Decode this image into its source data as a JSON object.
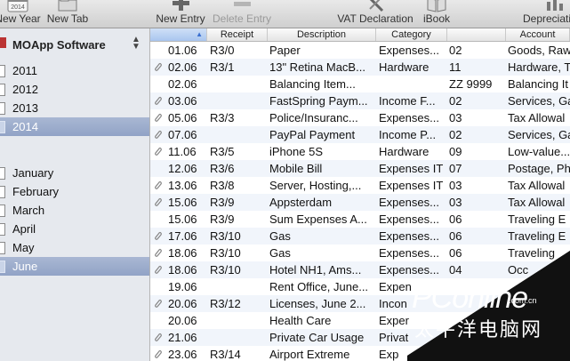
{
  "toolbar": {
    "new_year": "New Year",
    "new_tab": "New Tab",
    "new_entry": "New Entry",
    "delete_entry": "Delete Entry",
    "vat_declaration": "VAT Declaration",
    "ibook": "iBook",
    "depreciations": "Depreciations",
    "calendar_badge": "2014"
  },
  "sidebar": {
    "company": "MOApp Software",
    "years": [
      "2011",
      "2012",
      "2013",
      "2014"
    ],
    "months": [
      "January",
      "February",
      "March",
      "April",
      "May",
      "June"
    ]
  },
  "table": {
    "headers": [
      "Receipt",
      "Description",
      "Category",
      "Account"
    ],
    "rows": [
      {
        "date": "01.06",
        "receipt": "R3/0",
        "desc": "Paper",
        "cat": "Expenses...",
        "acct": "02",
        "acct_name": "Goods, Raw",
        "clip": false
      },
      {
        "date": "02.06",
        "receipt": "R3/1",
        "desc": "13\" Retina MacB...",
        "cat": "Hardware",
        "acct": "11",
        "acct_name": "Hardware, T",
        "clip": true
      },
      {
        "date": "02.06",
        "receipt": "",
        "desc": "Balancing Item...",
        "cat": "",
        "acct": "ZZ 9999",
        "acct_name": "Balancing It",
        "clip": false
      },
      {
        "date": "03.06",
        "receipt": "",
        "desc": "FastSpring Paym...",
        "cat": "Income F...",
        "acct": "02",
        "acct_name": "Services, Ga",
        "clip": true
      },
      {
        "date": "05.06",
        "receipt": "R3/3",
        "desc": "Police/Insuranc...",
        "cat": "Expenses...",
        "acct": "03",
        "acct_name": "Tax Allowal",
        "clip": true
      },
      {
        "date": "07.06",
        "receipt": "",
        "desc": "PayPal Payment",
        "cat": "Income P...",
        "acct": "02",
        "acct_name": "Services, Ga",
        "clip": true
      },
      {
        "date": "11.06",
        "receipt": "R3/5",
        "desc": "iPhone 5S",
        "cat": "Hardware",
        "acct": "09",
        "acct_name": "Low-value...",
        "clip": true
      },
      {
        "date": "12.06",
        "receipt": "R3/6",
        "desc": "Mobile Bill",
        "cat": "Expenses IT",
        "acct": "07",
        "acct_name": "Postage, Ph",
        "clip": false
      },
      {
        "date": "13.06",
        "receipt": "R3/8",
        "desc": "Server, Hosting,...",
        "cat": "Expenses IT",
        "acct": "03",
        "acct_name": "Tax Allowal",
        "clip": true
      },
      {
        "date": "15.06",
        "receipt": "R3/9",
        "desc": "Appsterdam",
        "cat": "Expenses...",
        "acct": "03",
        "acct_name": "Tax Allowal",
        "clip": true
      },
      {
        "date": "15.06",
        "receipt": "R3/9",
        "desc": "Sum Expenses A...",
        "cat": "Expenses...",
        "acct": "06",
        "acct_name": "Traveling E",
        "clip": false
      },
      {
        "date": "17.06",
        "receipt": "R3/10",
        "desc": "Gas",
        "cat": "Expenses...",
        "acct": "06",
        "acct_name": "Traveling E",
        "clip": true
      },
      {
        "date": "18.06",
        "receipt": "R3/10",
        "desc": "Gas",
        "cat": "Expenses...",
        "acct": "06",
        "acct_name": "Traveling",
        "clip": true
      },
      {
        "date": "18.06",
        "receipt": "R3/10",
        "desc": "Hotel NH1, Ams...",
        "cat": "Expenses...",
        "acct": "04",
        "acct_name": "Occ",
        "clip": true
      },
      {
        "date": "19.06",
        "receipt": "",
        "desc": "Rent Office, June...",
        "cat": "Expen",
        "acct": "",
        "acct_name": "",
        "clip": false
      },
      {
        "date": "20.06",
        "receipt": "R3/12",
        "desc": "Licenses, June 2...",
        "cat": "Incon",
        "acct": "",
        "acct_name": "",
        "clip": true
      },
      {
        "date": "20.06",
        "receipt": "",
        "desc": "Health Care",
        "cat": "Exper",
        "acct": "",
        "acct_name": "",
        "clip": false
      },
      {
        "date": "21.06",
        "receipt": "",
        "desc": "Private Car Usage",
        "cat": "Privat",
        "acct": "",
        "acct_name": "",
        "clip": true
      },
      {
        "date": "23.06",
        "receipt": "R3/14",
        "desc": "Airport Extreme",
        "cat": "Exp",
        "acct": "",
        "acct_name": "",
        "clip": true
      }
    ]
  },
  "watermark": {
    "brand": "PConline",
    "domain": ".com.cn",
    "cn": "太平洋电脑网"
  },
  "colors": {
    "selection": "#9aabcb",
    "sidebar_bg": "#e6e9ee",
    "row_alt": "#f1f5fb",
    "sort_header": "#a9c5ee"
  }
}
